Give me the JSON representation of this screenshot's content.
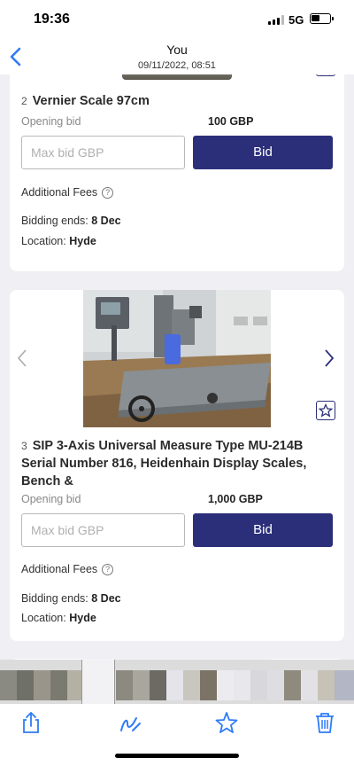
{
  "status": {
    "time": "19:36",
    "network": "5G"
  },
  "header": {
    "title": "You",
    "subtitle": "09/11/2022, 08:51"
  },
  "lots": [
    {
      "number": "2",
      "title": "Vernier Scale 97cm",
      "opening_bid_label": "Opening bid",
      "opening_bid_value": "100 GBP",
      "maxbid_placeholder": "Max bid GBP",
      "bid_label": "Bid",
      "fees_label": "Additional Fees",
      "help_glyph": "?",
      "ends_label": "Bidding ends:",
      "ends_value": "8 Dec",
      "location_label": "Location:",
      "location_value": "Hyde"
    },
    {
      "number": "3",
      "title": "SIP 3-Axis Universal Measure Type MU-214B Serial Number 816, Heidenhain Display Scales, Bench &",
      "opening_bid_label": "Opening bid",
      "opening_bid_value": "1,000 GBP",
      "maxbid_placeholder": "Max bid GBP",
      "bid_label": "Bid",
      "fees_label": "Additional Fees",
      "help_glyph": "?",
      "ends_label": "Bidding ends:",
      "ends_value": "8 Dec",
      "location_label": "Location:",
      "location_value": "Hyde"
    }
  ],
  "icons": {
    "back": "chevron-left-icon",
    "share": "share-icon",
    "markup": "markup-icon",
    "favorite": "star-icon",
    "delete": "trash-icon",
    "watch": "star-outline-icon",
    "prev": "chevron-left-icon",
    "next": "chevron-right-icon"
  },
  "colors": {
    "accent": "#2b2f7a",
    "ios_blue": "#2f7bf6",
    "background": "#efeff4"
  }
}
